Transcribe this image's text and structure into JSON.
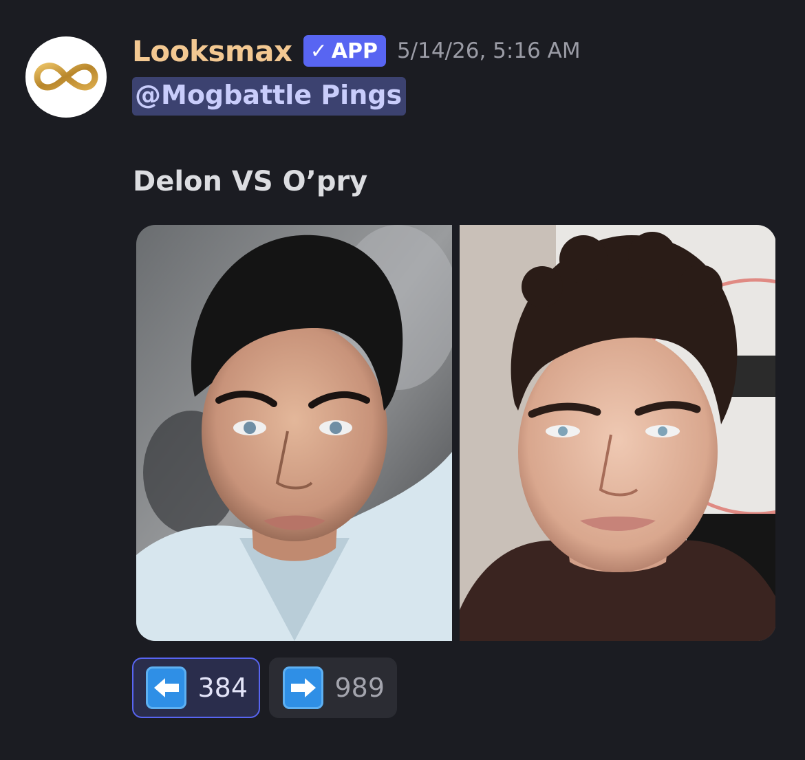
{
  "message": {
    "author": "Looksmax",
    "badge": {
      "check": "✓",
      "label": "APP"
    },
    "timestamp": "5/14/26, 5:16 AM",
    "mention": "@Mogbattle Pings",
    "text": "Delon VS O’pry",
    "avatar_icon": "infinity-logo-icon",
    "images": [
      {
        "name": "left-photo",
        "description_icon": "photo-portrait-dark-hair-white-shirt"
      },
      {
        "name": "right-photo",
        "description_icon": "photo-portrait-curly-hair-leather-jacket"
      }
    ],
    "reactions": [
      {
        "emoji": "left-arrow-icon",
        "count": "384",
        "selected": true
      },
      {
        "emoji": "right-arrow-icon",
        "count": "989",
        "selected": false
      }
    ]
  },
  "colors": {
    "background": "#1b1c22",
    "username": "#f3c892",
    "app_badge": "#5865f2",
    "mention_bg": "#3c4270",
    "mention_text": "#c9cdfb",
    "timestamp": "#9b9ca6",
    "reaction_active_border": "#5865f2"
  }
}
